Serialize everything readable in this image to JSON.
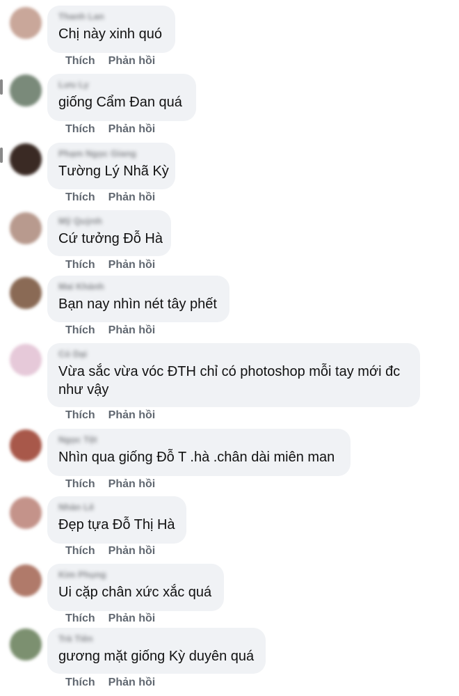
{
  "actions": {
    "like_label": "Thích",
    "reply_label": "Phản hồi"
  },
  "comments": [
    {
      "name": "Thanh Lan",
      "text": "Chị này xinh quó",
      "avatar_color": "#c9a79a"
    },
    {
      "name": "Lưu Ly",
      "text": "giống Cẩm Đan quá",
      "avatar_color": "#7a8a7a"
    },
    {
      "name": "Phạm Ngọc Giang",
      "text": "Tường Lý Nhã Kỳ",
      "avatar_color": "#3a2a24"
    },
    {
      "name": "Mỹ Quỳnh",
      "text": "Cứ tưởng Đỗ Hà",
      "avatar_color": "#b89a8e"
    },
    {
      "name": "Mai Khánh",
      "text": "Bạn nay nhìn nét tây phết",
      "avatar_color": "#8a6a55"
    },
    {
      "name": "Cỏ Dại",
      "text": "Vừa sắc vừa vóc ĐTH chỉ có photoshop mỗi tay mới đc như vậy",
      "avatar_color": "#e6c9d9"
    },
    {
      "name": "Ngọc Tệt",
      "text": "Nhìn qua giống Đỗ T .hà .chân dài miên man",
      "avatar_color": "#a8584a"
    },
    {
      "name": "Nhàn Lê",
      "text": "Đẹp tựa Đỗ Thị Hà",
      "avatar_color": "#c4938a"
    },
    {
      "name": "Kim Phụng",
      "text": "Ui cặp chân xức xắc quá",
      "avatar_color": "#b07a6a"
    },
    {
      "name": "Trà Tiên",
      "text": "gương mặt giống Kỳ duyên quá",
      "avatar_color": "#7c9070"
    }
  ]
}
